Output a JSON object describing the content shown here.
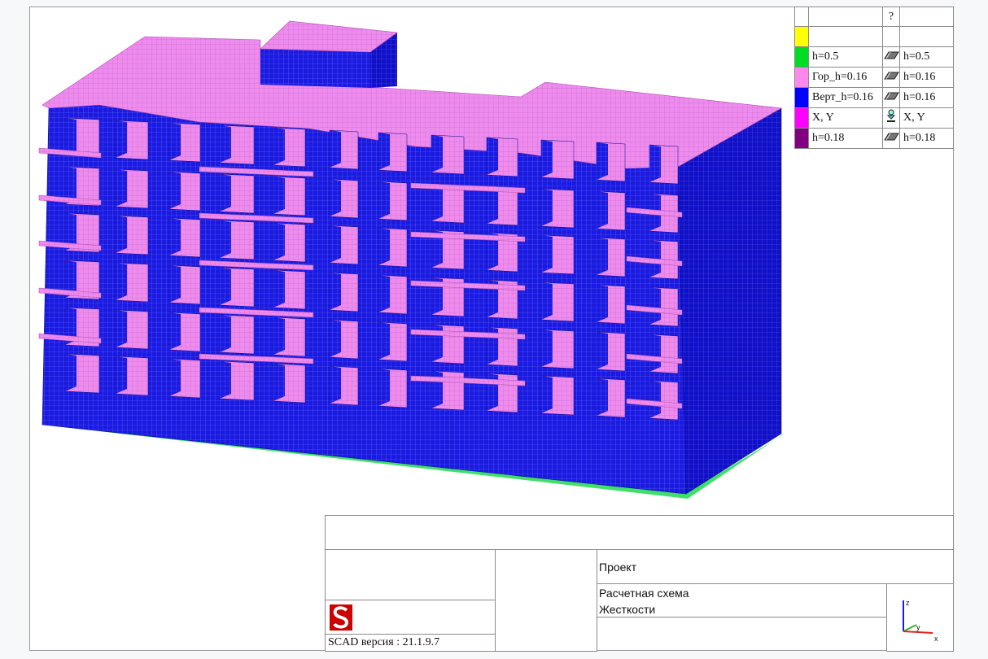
{
  "legend": {
    "header_icon": "?",
    "rows": [
      {
        "color": "#ffff00",
        "label": "",
        "icon": "",
        "label2": ""
      },
      {
        "color": "#00dd22",
        "label": "h=0.5",
        "icon": "plate-icon",
        "label2": "h=0.5"
      },
      {
        "color": "#ff88ee",
        "label": "Гор_h=0.16",
        "icon": "plate-icon",
        "label2": "h=0.16"
      },
      {
        "color": "#0000ff",
        "label": "Верт_h=0.16",
        "icon": "plate-icon",
        "label2": "h=0.16"
      },
      {
        "color": "#ff00ff",
        "label": "X, Y",
        "icon": "support-icon",
        "label2": "X, Y"
      },
      {
        "color": "#800080",
        "label": "h=0.18",
        "icon": "plate-icon",
        "label2": "h=0.18"
      }
    ]
  },
  "colors": {
    "wall": "#1a1ae0",
    "slab": "#ee8cee",
    "foundation": "#3ee06a",
    "mesh": "#7070ff"
  },
  "title_block": {
    "project_label": "Проект",
    "scheme_label": "Расчетная схема",
    "stiffness_label": "Жесткости",
    "version_text": "SCAD версия : 21.1.9.7",
    "axis_labels": {
      "z": "z",
      "y": "y",
      "x": "x"
    }
  }
}
